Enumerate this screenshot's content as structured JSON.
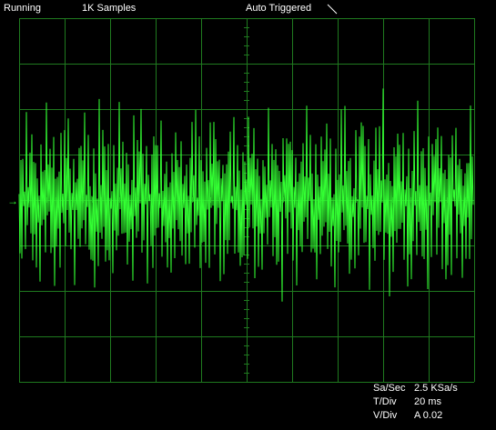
{
  "status": {
    "run_state": "Running",
    "samples": "1K Samples",
    "trigger": "Auto Triggered",
    "trigger_slope_icon": "falling-edge-icon"
  },
  "readouts": {
    "sample_rate_label": "Sa/Sec",
    "sample_rate_value": "2.5 KSa/s",
    "time_div_label": "T/Div",
    "time_div_value": "20 ms",
    "volt_div_label": "V/Div",
    "volt_div_value": "A 0.02"
  },
  "colors": {
    "background": "#000000",
    "grid": "#1f7a1f",
    "trace": "#33ff33",
    "text": "#ffffff"
  },
  "chart_data": {
    "type": "line",
    "title": "",
    "xlabel": "",
    "ylabel": "",
    "grid": true,
    "xlim": [
      0,
      200
    ],
    "ylim": [
      -0.1,
      0.1
    ],
    "x_unit": "ms",
    "y_unit": "V",
    "series": [
      {
        "channel": "A",
        "channel_marker": "→",
        "color": "#33ff33",
        "samples": 500,
        "sample_interval_ms": 0.4,
        "waveform": "dense oscillation, approx ±0.065 V envelope centered at 0 V",
        "approx_peak_v": 0.065
      }
    ]
  }
}
